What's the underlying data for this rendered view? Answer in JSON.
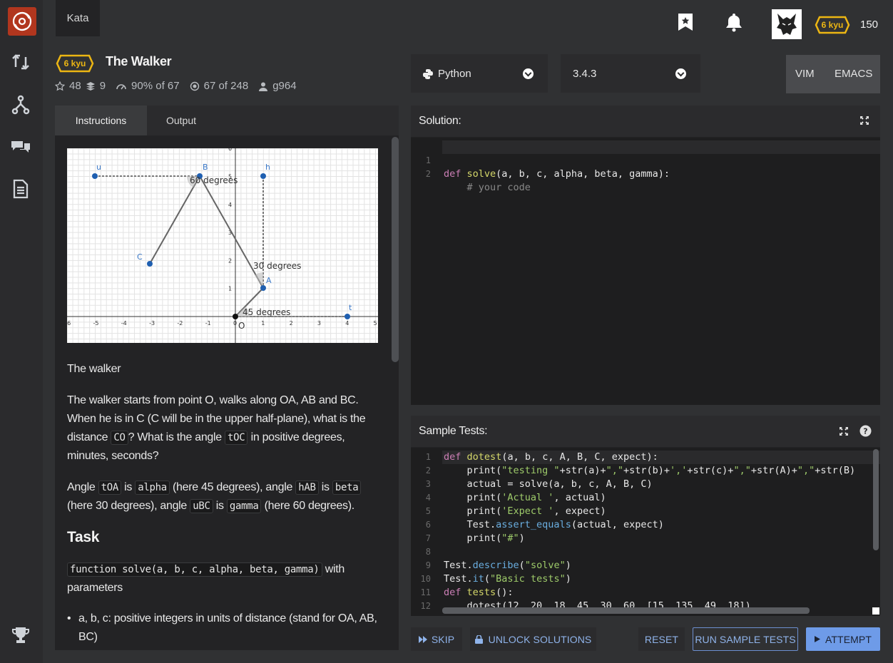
{
  "topbar": {
    "tab_label": "Kata",
    "rank_badge": "6 kyu",
    "honor": "150",
    "icons": [
      "bookmark-icon",
      "bell-icon",
      "avatar"
    ]
  },
  "kata": {
    "rank": "6 kyu",
    "title": "The Walker",
    "stars": "48",
    "collections": "9",
    "satisfaction_pct": "90%",
    "satisfaction_of": "of 67",
    "completed": "67",
    "completed_of": "of 248",
    "author": "g964"
  },
  "tabs": {
    "instructions": "Instructions",
    "output": "Output"
  },
  "graph": {
    "points": [
      "u",
      "B",
      "h",
      "C",
      "A",
      "O",
      "t"
    ],
    "labels": {
      "deg60": "60 degrees",
      "deg30": "30 degrees",
      "deg45": "45 degrees"
    },
    "x_ticks": [
      "-6",
      "-5",
      "-4",
      "-3",
      "-2",
      "-1",
      "0",
      "1",
      "2",
      "3",
      "4",
      "5"
    ],
    "y_ticks": [
      "1",
      "2",
      "3",
      "4",
      "5",
      "6"
    ]
  },
  "description": {
    "heading": "The walker",
    "p1_a": "The walker starts from point O, walks along OA, AB and BC. When he is in C (C will be in the upper half-plane), what is the distance ",
    "p1_code1": "CO",
    "p1_b": "? What is the angle ",
    "p1_code2": "tOC",
    "p1_c": " in positive degrees, minutes, seconds?",
    "p2_a": "Angle ",
    "p2_c1": "tOA",
    "p2_is": " is ",
    "p2_c2": "alpha",
    "p2_b": " (here 45 degrees), angle ",
    "p2_c3": "hAB",
    "p2_c4": "beta",
    "p2_c": " (here 30 degrees), angle ",
    "p2_c5": "uBC",
    "p2_c6": "gamma",
    "p2_d": " (here 60 degrees).",
    "task_heading": "Task",
    "task_code": "function solve(a, b, c, alpha, beta, gamma)",
    "task_text": " with parameters",
    "bullet1": "a, b, c: positive integers in units of distance (stand for OA, AB, BC)"
  },
  "language": {
    "name": "Python",
    "version": "3.4.3"
  },
  "modes": {
    "vim": "VIM",
    "emacs": "EMACS"
  },
  "solution": {
    "title": "Solution:",
    "lines": [
      {
        "n": "1",
        "text": "def solve(a, b, c, alpha, beta, gamma):"
      },
      {
        "n": "2",
        "text": "    # your code"
      }
    ]
  },
  "sample_tests": {
    "title": "Sample Tests:",
    "lines": [
      {
        "n": "1",
        "text": "def dotest(a, b, c, A, B, C, expect):"
      },
      {
        "n": "2",
        "text": "    print(\"testing \"+str(a)+\",\"+str(b)+','+str(c)+\",\"+str(A)+\",\"+str(B)"
      },
      {
        "n": "3",
        "text": "    actual = solve(a, b, c, A, B, C)"
      },
      {
        "n": "4",
        "text": "    print('Actual ', actual)"
      },
      {
        "n": "5",
        "text": "    print('Expect ', expect)"
      },
      {
        "n": "6",
        "text": "    Test.assert_equals(actual, expect)"
      },
      {
        "n": "7",
        "text": "    print(\"#\")"
      },
      {
        "n": "8",
        "text": ""
      },
      {
        "n": "9",
        "text": "Test.describe(\"solve\")"
      },
      {
        "n": "10",
        "text": "Test.it(\"Basic tests\")"
      },
      {
        "n": "11",
        "text": "def tests():"
      },
      {
        "n": "12",
        "text": "    dotest(12, 20, 18, 45, 30, 60, [15, 135, 49, 18])"
      }
    ]
  },
  "buttons": {
    "skip": "SKIP",
    "unlock": "UNLOCK SOLUTIONS",
    "reset": "RESET",
    "run": "RUN SAMPLE TESTS",
    "attempt": "ATTEMPT"
  }
}
